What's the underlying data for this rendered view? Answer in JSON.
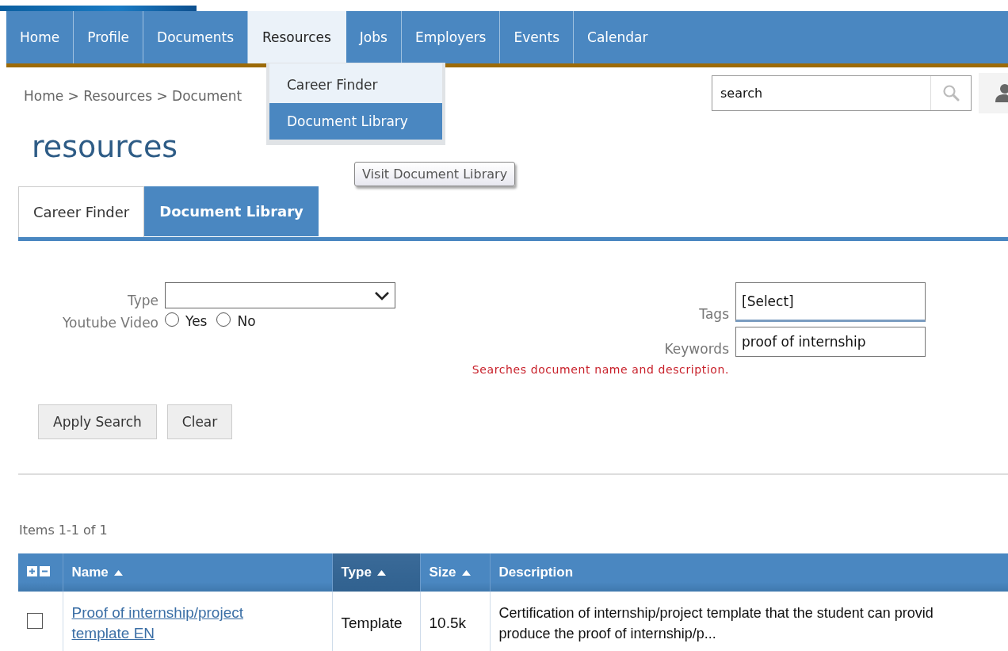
{
  "nav": {
    "items": [
      {
        "label": "Home",
        "selected": false
      },
      {
        "label": "Profile",
        "selected": false
      },
      {
        "label": "Documents",
        "selected": false
      },
      {
        "label": "Resources",
        "selected": true
      },
      {
        "label": "Jobs",
        "selected": false
      },
      {
        "label": "Employers",
        "selected": false
      },
      {
        "label": "Events",
        "selected": false
      },
      {
        "label": "Calendar",
        "selected": false
      }
    ],
    "dropdown": [
      {
        "label": "Career Finder",
        "selected": false
      },
      {
        "label": "Document Library",
        "selected": true
      }
    ],
    "tooltip": "Visit Document Library"
  },
  "breadcrumb": "Home > Resources > Document",
  "search": {
    "value": "search"
  },
  "page_title": "resources",
  "tabs": [
    {
      "label": "Career Finder",
      "selected": false
    },
    {
      "label": "Document Library",
      "selected": true
    }
  ],
  "filters": {
    "type_label": "Type",
    "youtube_label": "Youtube Video",
    "youtube_options": [
      {
        "label": "Yes",
        "checked": false
      },
      {
        "label": "No",
        "checked": false
      }
    ],
    "tags_label": "Tags",
    "tags_value": "[Select]",
    "keywords_label": "Keywords",
    "keywords_value": "proof of internship",
    "hint": "Searches document name and description.",
    "buttons": [
      "Apply Search",
      "Clear"
    ]
  },
  "items_count": "Items 1-1 of 1",
  "table": {
    "columns": [
      {
        "label": "Name",
        "sort_arrow": true,
        "selected": false
      },
      {
        "label": "Type",
        "sort_arrow": true,
        "selected": true
      },
      {
        "label": "Size",
        "sort_arrow": true,
        "selected": false
      },
      {
        "label": "Description",
        "sort_arrow": false,
        "selected": false
      }
    ],
    "rows": [
      {
        "checked": false,
        "name": "Proof of internship/project template EN",
        "type": "Template",
        "size": "10.5k",
        "description": [
          "Certification of internship/project template that the student can provid",
          "produce the proof of internship/p..."
        ]
      }
    ]
  }
}
